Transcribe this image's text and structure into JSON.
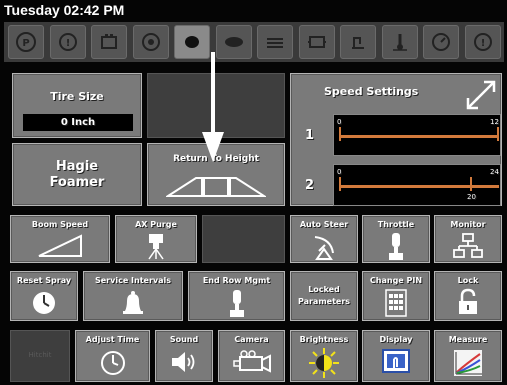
{
  "clock": "Tuesday 02:42 PM",
  "top_icons": [
    {
      "name": "parking-brake-icon"
    },
    {
      "name": "brake-icon"
    },
    {
      "name": "battery-icon"
    },
    {
      "name": "steering-icon"
    },
    {
      "name": "mist-icon",
      "active": true
    },
    {
      "name": "spray-icon"
    },
    {
      "name": "fluid-level-icon"
    },
    {
      "name": "engine-icon"
    },
    {
      "name": "hydraulic-icon"
    },
    {
      "name": "temperature-icon"
    },
    {
      "name": "pressure-icon"
    },
    {
      "name": "warning-icon"
    }
  ],
  "tire_size": {
    "label": "Tire Size",
    "value": "0 Inch"
  },
  "hagie_foamer": {
    "label": "Hagie\nFoamer"
  },
  "return_to_height": {
    "label": "Return To Height"
  },
  "speed_settings": {
    "title": "Speed Settings",
    "rows": [
      {
        "index": "1",
        "min": "0",
        "max": "12",
        "current": "",
        "level": 1.0
      },
      {
        "index": "2",
        "min": "0",
        "max": "24",
        "current": "20",
        "level": 0.83
      }
    ]
  },
  "row3": {
    "boom_speed": "Boom Speed",
    "ax_purge": "AX Purge",
    "auto_steer": "Auto Steer",
    "throttle": "Throttle",
    "monitor": "Monitor"
  },
  "row4": {
    "reset_spray": "Reset Spray",
    "service_intervals": "Service Intervals",
    "end_row_mgmt": "End Row Mgmt",
    "locked_parameters": "Locked\nParameters",
    "change_pin": "Change PIN",
    "lock": "Lock"
  },
  "row5": {
    "left_tile": "Hitchit",
    "adjust_time": "Adjust Time",
    "sound": "Sound",
    "camera": "Camera",
    "brightness": "Brightness",
    "display": "Display",
    "measure": "Measure"
  }
}
